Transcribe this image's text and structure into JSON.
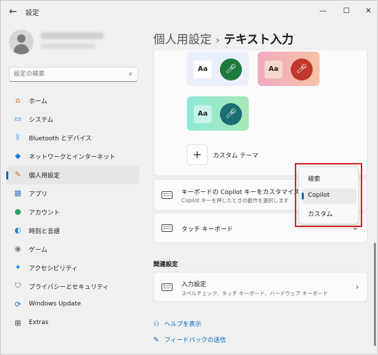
{
  "window": {
    "title": "設定",
    "back": "←",
    "minimize": "—",
    "maximize": "☐",
    "close": "✕"
  },
  "sidebar": {
    "search_placeholder": "設定の検索",
    "items": [
      {
        "label": "ホーム",
        "icon": "home-icon",
        "glyph": "⌂",
        "color": "#c36b2b"
      },
      {
        "label": "システム",
        "icon": "system-icon",
        "glyph": "▭",
        "color": "#1f7ad6"
      },
      {
        "label": "Bluetooth とデバイス",
        "icon": "bluetooth-icon",
        "glyph": "ᛒ",
        "color": "#1f7ad6"
      },
      {
        "label": "ネットワークとインターネット",
        "icon": "network-icon",
        "glyph": "◆",
        "color": "#1f7ad6"
      },
      {
        "label": "個人用設定",
        "icon": "personalization-icon",
        "glyph": "✎",
        "color": "#c36b2b",
        "active": true
      },
      {
        "label": "アプリ",
        "icon": "apps-icon",
        "glyph": "▦",
        "color": "#4a7ab8"
      },
      {
        "label": "アカウント",
        "icon": "account-icon",
        "glyph": "●",
        "color": "#2aa06a"
      },
      {
        "label": "時刻と言語",
        "icon": "time-language-icon",
        "glyph": "◐",
        "color": "#1f7ad6"
      },
      {
        "label": "ゲーム",
        "icon": "gaming-icon",
        "glyph": "◉",
        "color": "#7a7a7a"
      },
      {
        "label": "アクセシビリティ",
        "icon": "accessibility-icon",
        "glyph": "✦",
        "color": "#1f7ad6"
      },
      {
        "label": "プライバシーとセキュリティ",
        "icon": "shield-icon",
        "glyph": "⛉",
        "color": "#6b6b6b"
      },
      {
        "label": "Windows Update",
        "icon": "windows-update-icon",
        "glyph": "⟳",
        "color": "#1f7ad6"
      },
      {
        "label": "Extras",
        "icon": "extras-icon",
        "glyph": "⊞",
        "color": "#333333"
      }
    ]
  },
  "main": {
    "breadcrumb_parent": "個人用設定",
    "breadcrumb_sep": "›",
    "breadcrumb_current": "テキスト入力",
    "themes": [
      {
        "aa": "Aa",
        "bg": "#eaf0fb",
        "aa_bg": "#ffffff",
        "mic_bg": "#1e7a3c"
      },
      {
        "aa": "Aa",
        "bg": "#f4b9a9",
        "aa_bg": "#f7d6cc",
        "mic_bg": "#c0392b"
      },
      {
        "aa": "Aa",
        "bg": "#7fe0cc",
        "aa_bg": "#c8f2e8",
        "mic_bg": "#1b6f73"
      }
    ],
    "custom_theme_label": "カスタム テーマ",
    "copilot_key_title": "キーボードの Copilot キーをカスタマイズする",
    "copilot_key_subtitle": "Copilot キーを押したときの動作を選択します",
    "touch_keyboard_title": "タッチ キーボード",
    "related_heading": "関連設定",
    "input_settings_title": "入力設定",
    "input_settings_subtitle": "スペルチェック、タッチ キーボード、ハードウェア キーボード",
    "help_link": "ヘルプを表示",
    "feedback_link": "フィードバックの送信"
  },
  "dropdown": {
    "options": [
      "検索",
      "Copilot",
      "カスタム"
    ],
    "selected": "Copilot"
  }
}
